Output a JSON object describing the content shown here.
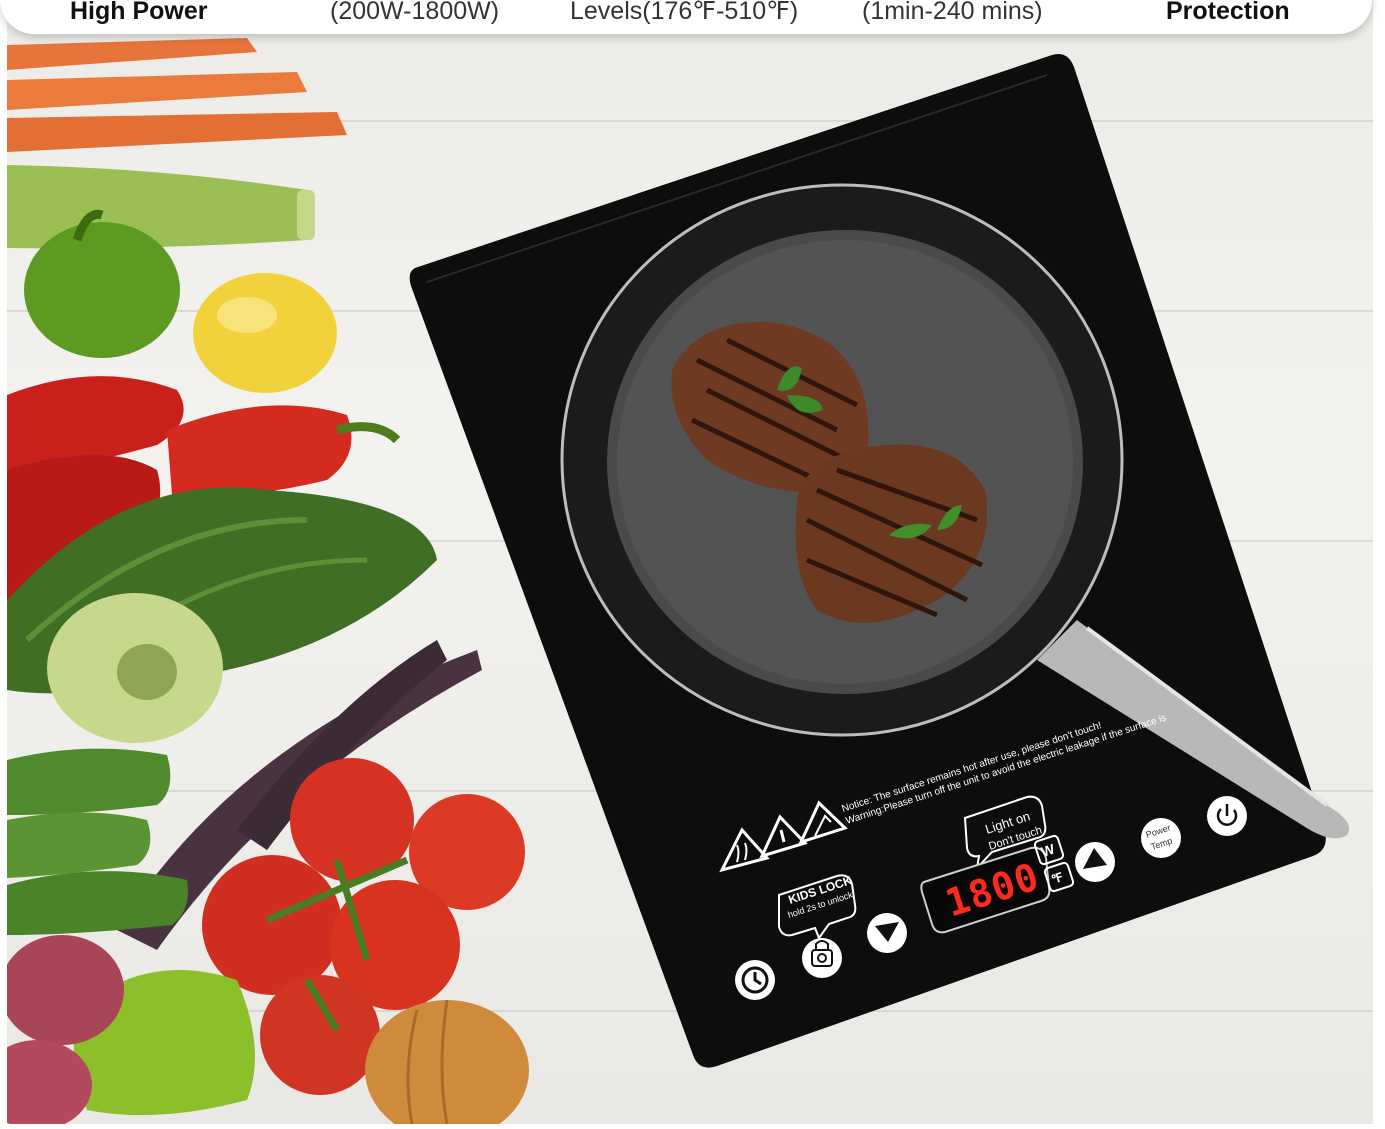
{
  "banner": {
    "features": [
      "High Power",
      "(200W-1800W)",
      "Levels(176℉-510℉)",
      "(1min-240 mins)",
      "Protection"
    ]
  },
  "cooktop": {
    "notice_line1": "Notice: The surface remains hot after use, please don't touch!",
    "notice_line2": "Warning:Please turn off the unit to avoid the electric leakage if the surface is",
    "light_line1": "Light on",
    "light_line2": "Don't touch",
    "display_value": "1800",
    "unit_w": "W",
    "unit_f": "℉",
    "kids_lock_line1": "KIDS LOCK",
    "kids_lock_line2": "hold 2s to unlock",
    "power_temp_line1": "Power",
    "power_temp_line2": "Temp"
  },
  "colors": {
    "cooktop": "#0d0d0d",
    "display": "#ff2a1f",
    "background": "#eeeeea"
  },
  "icons": [
    "power-icon",
    "timer-icon",
    "lock-icon",
    "up-arrow-icon",
    "down-arrow-icon",
    "warning-icon",
    "hot-surface-icon"
  ]
}
